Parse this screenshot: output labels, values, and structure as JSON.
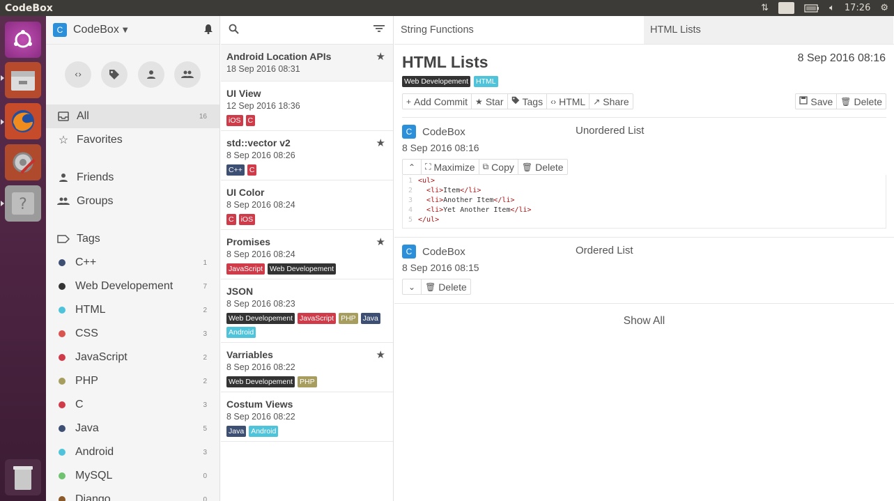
{
  "window": {
    "title": "CodeBox"
  },
  "panel": {
    "keyboard": "Hu",
    "time": "17:26"
  },
  "sidebar": {
    "app_name": "CodeBox",
    "app_letter": "C",
    "nav": [
      {
        "label": "All",
        "count": "16"
      },
      {
        "label": "Favorites",
        "count": ""
      },
      {
        "label": "Friends",
        "count": ""
      },
      {
        "label": "Groups",
        "count": ""
      }
    ],
    "tags_label": "Tags",
    "tags": [
      {
        "label": "C++",
        "count": "1",
        "color": "#3d4f73"
      },
      {
        "label": "Web Developement",
        "count": "7",
        "color": "#333333"
      },
      {
        "label": "HTML",
        "count": "2",
        "color": "#4fc3d9"
      },
      {
        "label": "CSS",
        "count": "3",
        "color": "#d9534f"
      },
      {
        "label": "JavaScript",
        "count": "2",
        "color": "#d03b4a"
      },
      {
        "label": "PHP",
        "count": "2",
        "color": "#a69d5f"
      },
      {
        "label": "C",
        "count": "3",
        "color": "#d03b4a"
      },
      {
        "label": "Java",
        "count": "5",
        "color": "#3d4f73"
      },
      {
        "label": "Android",
        "count": "3",
        "color": "#4fc3d9"
      },
      {
        "label": "MySQL",
        "count": "0",
        "color": "#6fc26f"
      },
      {
        "label": "Django",
        "count": "0",
        "color": "#8b5a2b"
      }
    ]
  },
  "notes": [
    {
      "title": "Android Location APIs",
      "date": "18 Sep 2016 08:31",
      "star": true,
      "tags": []
    },
    {
      "title": "UI View",
      "date": "12 Sep 2016 18:36",
      "star": false,
      "tags": [
        {
          "label": "iOS",
          "color": "#d03b4a"
        },
        {
          "label": "C",
          "color": "#d03b4a"
        }
      ]
    },
    {
      "title": "std::vector v2",
      "date": "8 Sep 2016 08:26",
      "star": true,
      "tags": [
        {
          "label": "C++",
          "color": "#3d4f73"
        },
        {
          "label": "C",
          "color": "#d03b4a"
        }
      ]
    },
    {
      "title": "UI Color",
      "date": "8 Sep 2016 08:24",
      "star": false,
      "tags": [
        {
          "label": "C",
          "color": "#d03b4a"
        },
        {
          "label": "iOS",
          "color": "#d03b4a"
        }
      ]
    },
    {
      "title": "Promises",
      "date": "8 Sep 2016 08:24",
      "star": true,
      "tags": [
        {
          "label": "JavaScript",
          "color": "#d03b4a"
        },
        {
          "label": "Web Developement",
          "color": "#333333"
        }
      ]
    },
    {
      "title": "JSON",
      "date": "8 Sep 2016 08:23",
      "star": false,
      "tags": [
        {
          "label": "Web Developement",
          "color": "#333333"
        },
        {
          "label": "JavaScript",
          "color": "#d03b4a"
        },
        {
          "label": "PHP",
          "color": "#a69d5f"
        },
        {
          "label": "Java",
          "color": "#3d4f73"
        },
        {
          "label": "Android",
          "color": "#4fc3d9"
        }
      ]
    },
    {
      "title": "Varriables",
      "date": "8 Sep 2016 08:22",
      "star": true,
      "tags": [
        {
          "label": "Web Developement",
          "color": "#333333"
        },
        {
          "label": "PHP",
          "color": "#a69d5f"
        }
      ]
    },
    {
      "title": "Costum Views",
      "date": "8 Sep 2016 08:22",
      "star": false,
      "tags": [
        {
          "label": "Java",
          "color": "#3d4f73"
        },
        {
          "label": "Android",
          "color": "#4fc3d9"
        }
      ]
    }
  ],
  "tabs": [
    {
      "label": "String Functions"
    },
    {
      "label": "HTML Lists"
    }
  ],
  "doc": {
    "title": "HTML Lists",
    "date": "8 Sep 2016 08:16",
    "tags": [
      {
        "label": "Web Developement",
        "color": "#333333"
      },
      {
        "label": "HTML",
        "color": "#4fc3d9"
      }
    ],
    "actions": {
      "add_commit": "Add Commit",
      "star": "Star",
      "tags": "Tags",
      "html": "HTML",
      "share": "Share",
      "save": "Save",
      "delete": "Delete"
    }
  },
  "commits": [
    {
      "author": "CodeBox",
      "letter": "C",
      "title": "Unordered List",
      "date": "8 Sep 2016 08:16",
      "maximize": "Maximize",
      "copy": "Copy",
      "delete": "Delete",
      "code": [
        {
          "n": "1",
          "text": "<ul>"
        },
        {
          "n": "2",
          "text": "  <li>Item</li>"
        },
        {
          "n": "3",
          "text": "  <li>Another Item</li>"
        },
        {
          "n": "4",
          "text": "  <li>Yet Another Item</li>"
        },
        {
          "n": "5",
          "text": "</ul>"
        }
      ]
    },
    {
      "author": "CodeBox",
      "letter": "C",
      "title": "Ordered List",
      "date": "8 Sep 2016 08:15",
      "delete": "Delete"
    }
  ],
  "show_all": "Show All"
}
